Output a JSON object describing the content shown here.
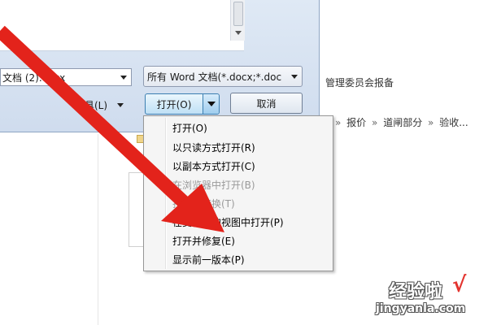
{
  "background_page": {
    "title_text": "管理委员会报备",
    "breadcrumb": [
      {
        "sep": "»",
        "text": "报价"
      },
      {
        "sep": "»",
        "text": "道闸部分"
      },
      {
        "sep": "»",
        "text": "验收..."
      }
    ]
  },
  "dialog": {
    "filename_value": "文档 (2).docx",
    "filetype_value": "所有 Word 文档(*.docx;*.doc",
    "tools_label": "工具(L)",
    "open_label": "打开(O)",
    "cancel_label": "取消"
  },
  "open_menu": {
    "items": [
      {
        "label": "打开(O)",
        "enabled": true
      },
      {
        "label": "以只读方式打开(R)",
        "enabled": true
      },
      {
        "label": "以副本方式打开(C)",
        "enabled": true
      },
      {
        "label": "在浏览器中打开(B)",
        "enabled": false
      },
      {
        "label": "打开时转换(T)",
        "enabled": false
      },
      {
        "label": "在受保护的视图中打开(P)",
        "enabled": true
      },
      {
        "label": "打开并修复(E)",
        "enabled": true
      },
      {
        "label": "显示前一版本(P)",
        "enabled": true
      }
    ]
  },
  "annotation": {
    "arrow_color": "#e3231b"
  },
  "watermark": {
    "brand": "经验啦",
    "check": "√",
    "url": "jingyanla.com"
  }
}
